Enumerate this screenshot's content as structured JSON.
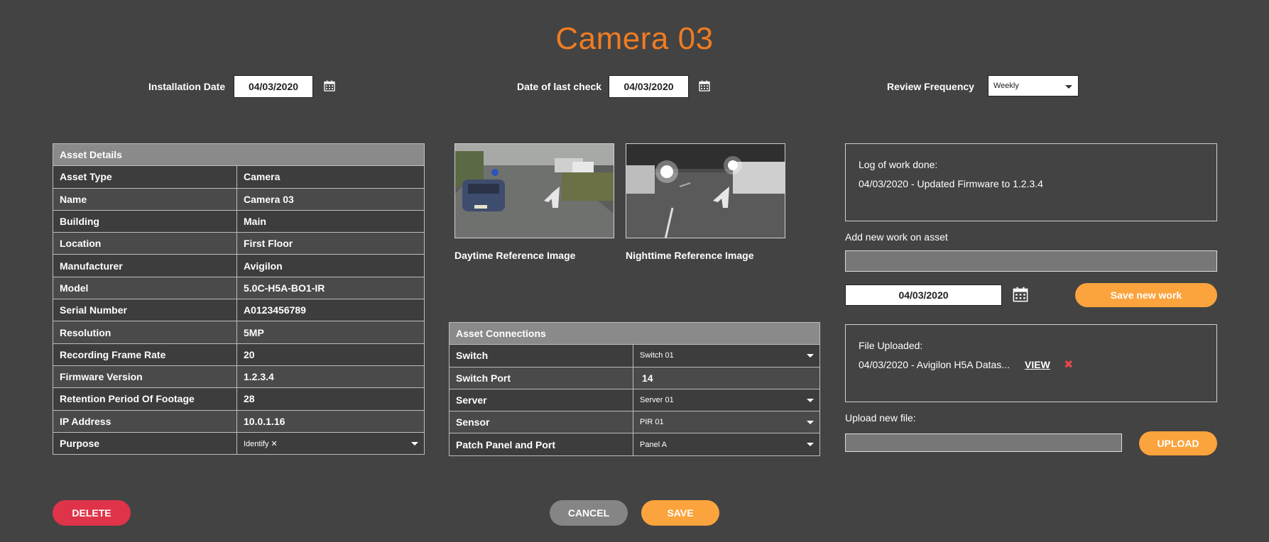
{
  "title": "Camera 03",
  "header": {
    "installation_date_label": "Installation Date",
    "installation_date": "04/03/2020",
    "last_check_label": "Date of last check",
    "last_check_date": "04/03/2020",
    "review_frequency_label": "Review Frequency",
    "review_frequency": "Weekly"
  },
  "asset_details": {
    "heading": "Asset Details",
    "rows": [
      {
        "label": "Asset Type",
        "value": "Camera"
      },
      {
        "label": "Name",
        "value": "Camera 03"
      },
      {
        "label": "Building",
        "value": "Main"
      },
      {
        "label": "Location",
        "value": "First Floor"
      },
      {
        "label": "Manufacturer",
        "value": "Avigilon"
      },
      {
        "label": "Model",
        "value": "5.0C-H5A-BO1-IR"
      },
      {
        "label": "Serial Number",
        "value": "A0123456789"
      },
      {
        "label": "Resolution",
        "value": "5MP"
      },
      {
        "label": "Recording Frame Rate",
        "value": "20"
      },
      {
        "label": "Firmware Version",
        "value": "1.2.3.4"
      },
      {
        "label": "Retention Period Of Footage",
        "value": "28"
      },
      {
        "label": "IP Address",
        "value": "10.0.1.16"
      }
    ],
    "purpose_label": "Purpose",
    "purpose_value": "Identify ✕"
  },
  "images": {
    "day_caption": "Daytime Reference Image",
    "night_caption": "Nighttime Reference Image"
  },
  "asset_connections": {
    "heading": "Asset Connections",
    "switch_label": "Switch",
    "switch_value": "Switch 01",
    "switch_port_label": "Switch Port",
    "switch_port_value": "14",
    "server_label": "Server",
    "server_value": "Server 01",
    "sensor_label": "Sensor",
    "sensor_value": "PIR 01",
    "patch_label": "Patch Panel and Port",
    "patch_value": "Panel A"
  },
  "log": {
    "heading": "Log of work done:",
    "entry": "04/03/2020 - Updated Firmware to 1.2.3.4",
    "add_label": "Add new work on asset",
    "new_work_date": "04/03/2020",
    "save_button": "Save new work"
  },
  "files": {
    "heading": "File Uploaded:",
    "entry": "04/03/2020 - Avigilon H5A Datas...",
    "view_link": "VIEW",
    "upload_label": "Upload new file:",
    "upload_button": "UPLOAD"
  },
  "footer": {
    "delete": "DELETE",
    "cancel": "CANCEL",
    "save": "SAVE"
  },
  "colors": {
    "background": "#434343",
    "title": "#f07c22",
    "accent_orange": "#fba33c",
    "delete_red": "#df3349",
    "cancel_gray": "#858585"
  }
}
